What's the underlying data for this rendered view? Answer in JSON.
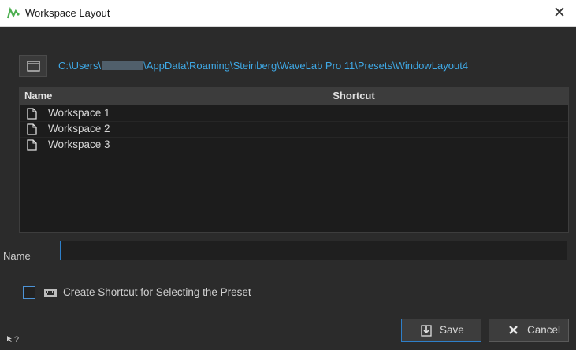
{
  "window": {
    "title": "Workspace Layout",
    "close_symbol": "✕"
  },
  "path": {
    "prefix": "C:\\Users\\",
    "suffix": "\\AppData\\Roaming\\Steinberg\\WaveLab Pro 11\\Presets\\WindowLayout4"
  },
  "table": {
    "columns": [
      "Name",
      "Shortcut"
    ],
    "rows": [
      {
        "name": "Workspace 1",
        "shortcut": ""
      },
      {
        "name": "Workspace 2",
        "shortcut": ""
      },
      {
        "name": "Workspace 3",
        "shortcut": ""
      }
    ]
  },
  "name_field": {
    "label": "Name",
    "value": ""
  },
  "shortcut_checkbox": {
    "label": "Create Shortcut for Selecting the Preset",
    "checked": false
  },
  "buttons": {
    "save": "Save",
    "cancel": "Cancel"
  },
  "help_symbol": "?",
  "colors": {
    "accent": "#2e7fc9",
    "path": "#3fa9e6",
    "background": "#2b2b2b"
  },
  "icons": [
    "wavelab-logo-icon",
    "close-icon",
    "folder-icon",
    "document-icon",
    "keyboard-icon",
    "save-icon",
    "cancel-x-icon",
    "help-cursor-icon"
  ]
}
